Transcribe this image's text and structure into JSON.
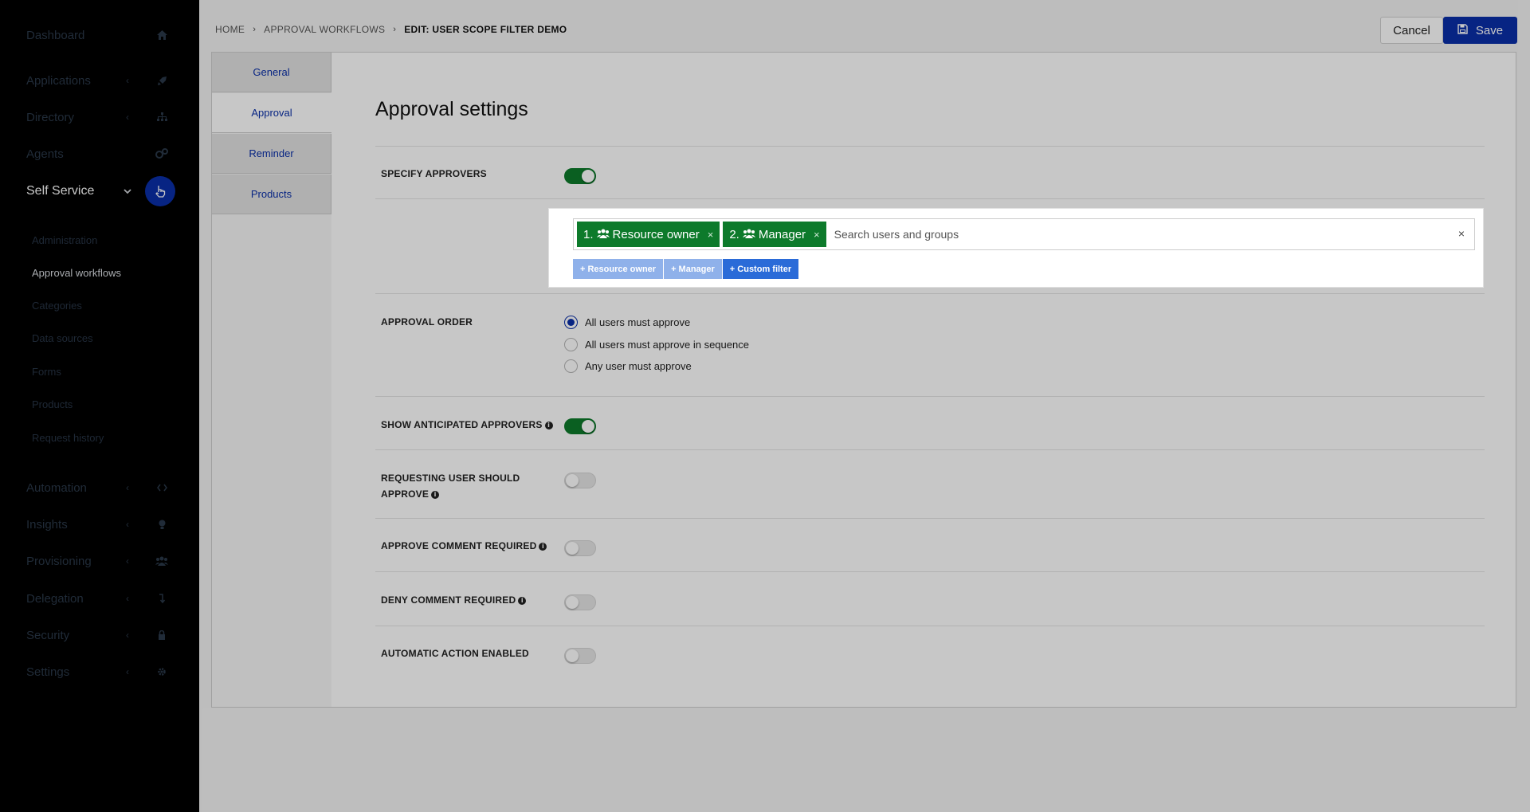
{
  "sidebar": {
    "items": [
      {
        "label": "Dashboard",
        "icon": "home-icon",
        "chevron": ""
      },
      {
        "label": "Applications",
        "icon": "rocket-icon",
        "chevron": "‹"
      },
      {
        "label": "Directory",
        "icon": "sitemap-icon",
        "chevron": "‹"
      },
      {
        "label": "Agents",
        "icon": "cogs-icon",
        "chevron": ""
      },
      {
        "label": "Self Service",
        "icon": "hand-pointer-icon",
        "chevron": "⌄"
      },
      {
        "label": "Automation",
        "icon": "code-icon",
        "chevron": "‹"
      },
      {
        "label": "Insights",
        "icon": "lightbulb-icon",
        "chevron": "‹"
      },
      {
        "label": "Provisioning",
        "icon": "users-icon",
        "chevron": "‹"
      },
      {
        "label": "Delegation",
        "icon": "level-down-icon",
        "chevron": "‹"
      },
      {
        "label": "Security",
        "icon": "lock-icon",
        "chevron": "‹"
      },
      {
        "label": "Settings",
        "icon": "gear-icon",
        "chevron": "‹"
      }
    ],
    "sub_items": [
      "Administration",
      "Approval workflows",
      "Categories",
      "Data sources",
      "Forms",
      "Products",
      "Request history"
    ]
  },
  "header": {
    "breadcrumb": [
      "HOME",
      "APPROVAL WORKFLOWS",
      "EDIT: USER SCOPE FILTER DEMO"
    ],
    "breadcrumb_sep": "›",
    "cancel_label": "Cancel",
    "save_label": "Save"
  },
  "tabs": [
    "General",
    "Approval",
    "Reminder",
    "Products"
  ],
  "content": {
    "title": "Approval settings",
    "specify_approvers": {
      "label": "SPECIFY APPROVERS",
      "on": true
    },
    "approvers": {
      "tags": [
        {
          "index": "1.",
          "label": "Resource owner"
        },
        {
          "index": "2.",
          "label": "Manager"
        }
      ],
      "tag_remove": "×",
      "search_placeholder": "Search users and groups",
      "clear": "×",
      "quick_buttons": [
        "+ Resource owner",
        "+ Manager",
        "+ Custom filter"
      ]
    },
    "approval_order": {
      "label": "APPROVAL ORDER",
      "options": [
        "All users must approve",
        "All users must approve in sequence",
        "Any user must approve"
      ],
      "selected_index": 0
    },
    "show_anticipated": {
      "label": "SHOW ANTICIPATED APPROVERS",
      "on": true
    },
    "requesting_user_line1": "REQUESTING USER SHOULD",
    "requesting_user_line2": "APPROVE",
    "approve_comment": "APPROVE COMMENT REQUIRED",
    "deny_comment": "DENY COMMENT REQUIRED",
    "automatic_action": "AUTOMATIC ACTION ENABLED",
    "info_glyph": "i"
  },
  "colors": {
    "primary": "#0a2fa8",
    "toggle_on": "#0d7a2b",
    "tag_green": "#0d7a2b",
    "sidebar_bg": "#000000"
  }
}
